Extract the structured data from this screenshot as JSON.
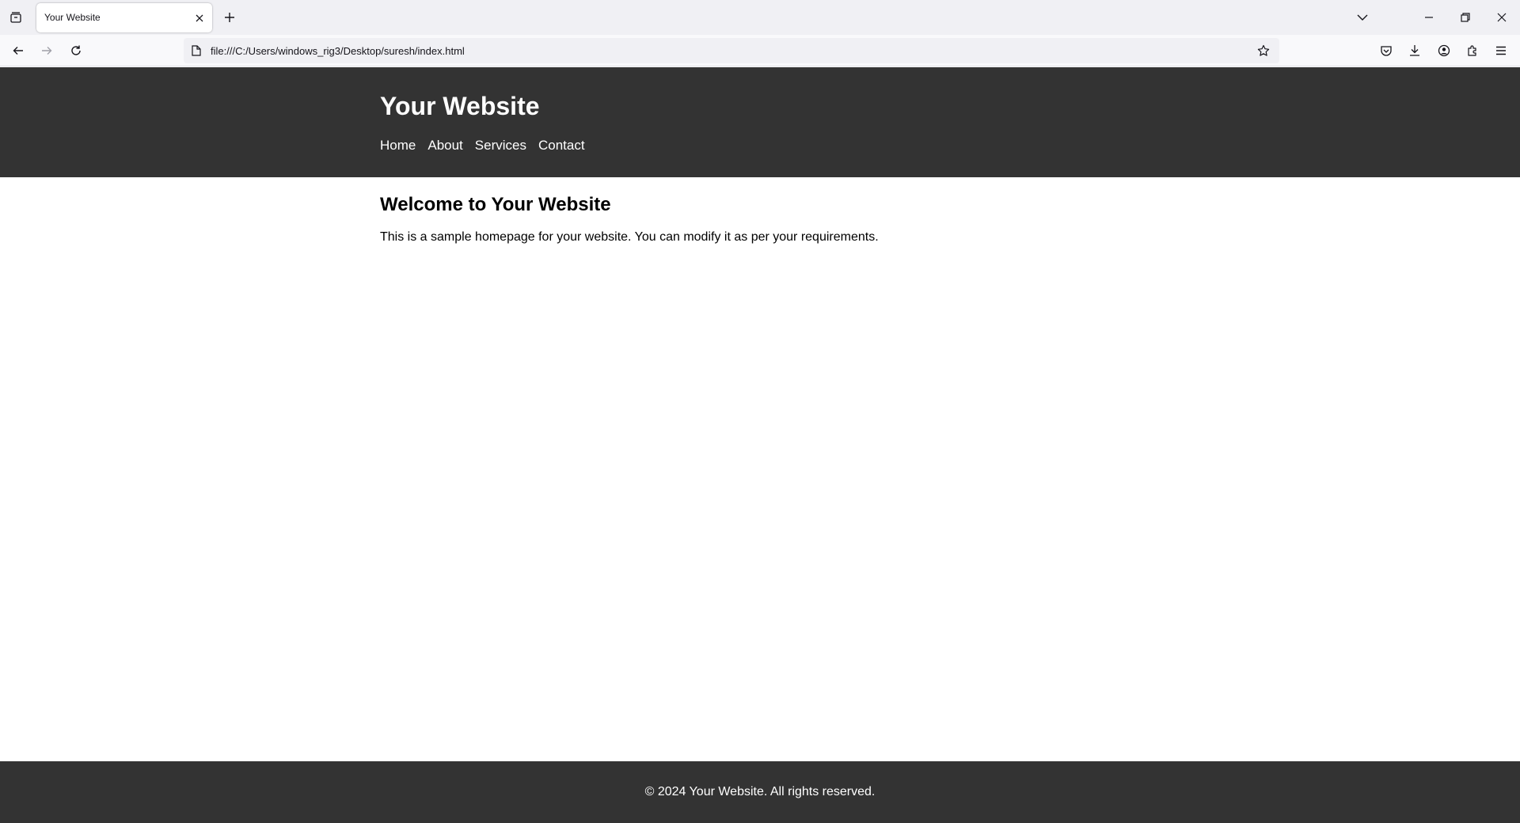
{
  "browser": {
    "tab_title": "Your Website",
    "url": "file:///C:/Users/windows_rig3/Desktop/suresh/index.html"
  },
  "page": {
    "site_title": "Your Website",
    "nav": [
      "Home",
      "About",
      "Services",
      "Contact"
    ],
    "heading": "Welcome to Your Website",
    "paragraph": "This is a sample homepage for your website. You can modify it as per your requirements.",
    "footer": "© 2024 Your Website. All rights reserved."
  },
  "colors": {
    "header_bg": "#333333",
    "footer_bg": "#333333",
    "page_bg": "#ffffff",
    "chrome_bg": "#f0f0f4"
  }
}
